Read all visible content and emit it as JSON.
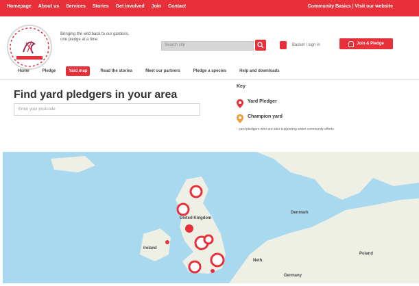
{
  "top_nav": {
    "items": [
      "Homepage",
      "About us",
      "Services",
      "Stories",
      "Get involved",
      "Join",
      "Contact"
    ],
    "right": "Community Basics | Visit our website"
  },
  "header": {
    "tagline": "Bringing the wild back to our gardens, one pledge at a time",
    "search_placeholder": "Search site",
    "account_label": "Basket / sign in",
    "cta_label": "Join & Pledge"
  },
  "main_nav": {
    "items": [
      {
        "label": "Home",
        "active": false
      },
      {
        "label": "Pledge",
        "active": false
      },
      {
        "label": "Yard map",
        "active": true
      },
      {
        "label": "Read the stories",
        "active": false
      },
      {
        "label": "Meet our partners",
        "active": false
      },
      {
        "label": "Pledge a species",
        "active": false
      },
      {
        "label": "Help and downloads",
        "active": false
      }
    ]
  },
  "finder": {
    "title": "Find yard pledgers in your area",
    "placeholder": "Enter your postcode"
  },
  "key": {
    "title": "Key",
    "items": [
      {
        "label": "Yard Pledger",
        "desc": "",
        "color": "#e8303a"
      },
      {
        "label": "Champion yard",
        "desc": "- yard pledgers who are also supporting wider community efforts",
        "color": "#f29a3c"
      }
    ]
  },
  "map": {
    "labels": {
      "uk": "United Kingdom",
      "ireland": "Ireland",
      "denmark": "Denmark",
      "germany": "Germany",
      "poland": "Poland",
      "neth": "Neth."
    },
    "colors": {
      "sea": "#a9d9ef",
      "land": "#eef0e6",
      "marker": "#e8303a"
    }
  }
}
